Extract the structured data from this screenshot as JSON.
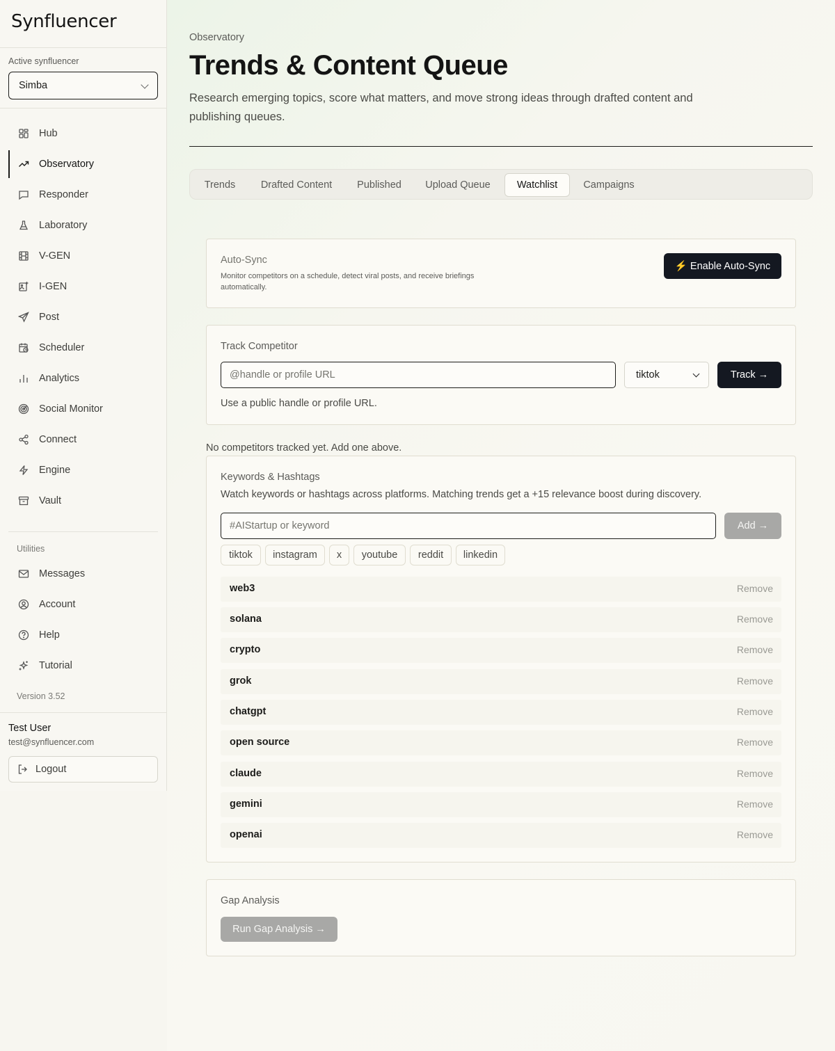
{
  "app": {
    "logo": "Synfluencer"
  },
  "sidebar": {
    "active_label": "Active synfluencer",
    "active_value": "Simba",
    "items": [
      {
        "label": "Hub"
      },
      {
        "label": "Observatory"
      },
      {
        "label": "Responder"
      },
      {
        "label": "Laboratory"
      },
      {
        "label": "V-GEN"
      },
      {
        "label": "I-GEN"
      },
      {
        "label": "Post"
      },
      {
        "label": "Scheduler"
      },
      {
        "label": "Analytics"
      },
      {
        "label": "Social Monitor"
      },
      {
        "label": "Connect"
      },
      {
        "label": "Engine"
      },
      {
        "label": "Vault"
      }
    ],
    "utilities_label": "Utilities",
    "utilities": [
      {
        "label": "Messages"
      },
      {
        "label": "Account"
      },
      {
        "label": "Help"
      },
      {
        "label": "Tutorial"
      }
    ],
    "version": "Version 3.52",
    "user": {
      "name": "Test User",
      "email": "test@synfluencer.com"
    },
    "logout_label": "Logout"
  },
  "header": {
    "breadcrumb": "Observatory",
    "title": "Trends & Content Queue",
    "subtitle": "Research emerging topics, score what matters, and move strong ideas through drafted content and publishing queues."
  },
  "tabs": [
    {
      "label": "Trends"
    },
    {
      "label": "Drafted Content"
    },
    {
      "label": "Published"
    },
    {
      "label": "Upload Queue"
    },
    {
      "label": "Watchlist"
    },
    {
      "label": "Campaigns"
    }
  ],
  "autosync": {
    "title": "Auto-Sync",
    "description": "Monitor competitors on a schedule, detect viral posts, and receive briefings automatically.",
    "button": "⚡ Enable Auto-Sync"
  },
  "competitor": {
    "title": "Track Competitor",
    "placeholder": "@handle or profile URL",
    "platform": "tiktok",
    "button": "Track →",
    "hint": "Use a public handle or profile URL.",
    "empty": "No competitors tracked yet. Add one above."
  },
  "keywords": {
    "title": "Keywords & Hashtags",
    "description": "Watch keywords or hashtags across platforms. Matching trends get a +15 relevance boost during discovery.",
    "placeholder": "#AIStartup or keyword",
    "add_button": "Add →",
    "platforms": [
      "tiktok",
      "instagram",
      "x",
      "youtube",
      "reddit",
      "linkedin"
    ],
    "list": [
      "web3",
      "solana",
      "crypto",
      "grok",
      "chatgpt",
      "open source",
      "claude",
      "gemini",
      "openai"
    ],
    "remove_label": "Remove"
  },
  "gap": {
    "title": "Gap Analysis",
    "button": "Run Gap Analysis →"
  }
}
